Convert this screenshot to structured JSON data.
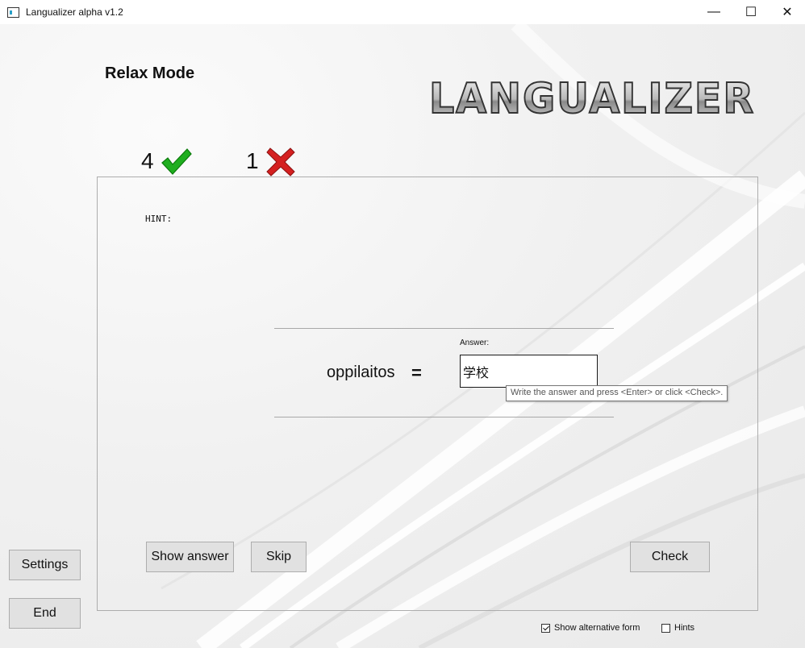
{
  "window": {
    "title": "Langualizer alpha v1.2",
    "minimize_glyph": "—",
    "maximize_glyph": "☐",
    "close_glyph": "✕"
  },
  "header": {
    "mode_title": "Relax Mode",
    "logo_text": "LANGUALIZER"
  },
  "score": {
    "correct": "4",
    "wrong": "1",
    "correct_icon": "green-check-icon",
    "wrong_icon": "red-x-icon",
    "correct_color": "#1fae1f",
    "wrong_color": "#d42020"
  },
  "quiz": {
    "hint_label": "HINT:",
    "word": "oppilaitos",
    "equals": "=",
    "answer_label": "Answer:",
    "answer_value": "学校",
    "tooltip": "Write the answer and press <Enter> or click <Check>."
  },
  "buttons": {
    "show_answer": "Show answer",
    "skip": "Skip",
    "check": "Check",
    "settings": "Settings",
    "end": "End"
  },
  "options": {
    "show_alternative_form": {
      "label": "Show alternative form",
      "checked": true
    },
    "hints": {
      "label": "Hints",
      "checked": false
    }
  }
}
